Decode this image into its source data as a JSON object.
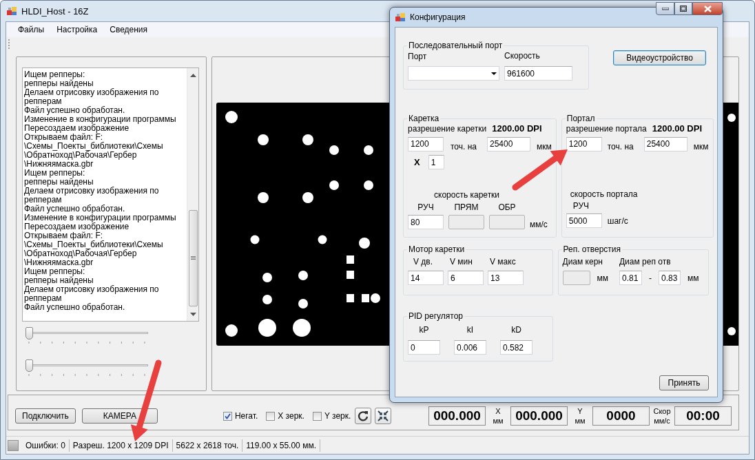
{
  "window": {
    "title": "HLDI_Host - 16Z"
  },
  "menu": [
    "Файлы",
    "Настройка",
    "Сведения"
  ],
  "log": {
    "lines": [
      "Ищем репперы:",
      "репперы найдены",
      "Делаем отрисовку изображения по",
      "репперам",
      "Файл успешно обработан.",
      "Изменение в конфигурации программы",
      "Пересоздаем изображение",
      "Открываем файл: F:",
      "\\Схемы_Поекты_библиотеки\\Схемы",
      "\\Обратноход\\Рабочая\\Гербер",
      "\\Нижняямаска.gbr",
      "Ищем репперы:",
      "репперы найдены",
      "Делаем отрисовку изображения по",
      "репперам",
      "Файл успешно обработан.",
      "Изменение в конфигурации программы",
      "Пересоздаем изображение",
      "Открываем файл: F:",
      "\\Схемы_Поекты_библиотеки\\Схемы",
      "\\Обратноход\\Рабочая\\Гербер",
      "\\Нижняямаска.gbr",
      "Ищем репперы:",
      "репперы найдены",
      "Делаем отрисовку изображения по",
      "репперам",
      "Файл успешно обработан."
    ]
  },
  "sliders": [
    {
      "level": 0
    },
    {
      "level": 0
    }
  ],
  "controls": {
    "buttons": [
      "Подключить",
      "КАМЕРА"
    ],
    "checkboxes": [
      {
        "label": "Негат.",
        "checked": true
      },
      {
        "label": "X зерк.",
        "checked": false
      },
      {
        "label": "Y зерк.",
        "checked": false
      }
    ]
  },
  "readouts": [
    {
      "value": "000.000",
      "label_top": "X",
      "label_bottom": "мм"
    },
    {
      "value": "000.000",
      "label_top": "Y",
      "label_bottom": "мм"
    },
    {
      "value": "0000",
      "label_top": "Скор",
      "label_bottom": "мм/с"
    },
    {
      "value": "00:00"
    }
  ],
  "status_bar": [
    "Ошибки: 0",
    "Разреш. 1200 x 1209 DPI",
    "5622 x 2618 точ.",
    "119.00 x 55.00 мм."
  ],
  "dialog": {
    "title": "Конфигурация",
    "serial_port": {
      "title": "Последовательный порт",
      "port_label": "Порт",
      "speed_label": "Скорость",
      "speed_value": "961600"
    },
    "video_button": "Видеоустройство",
    "carriage": {
      "title": "Каретка",
      "resolution_label": "разрешение каретки",
      "resolution": "1200.00 DPI",
      "dots": "1200",
      "dots_unit": "точ. на",
      "microns": "25400",
      "microns_unit": "мкм",
      "multiplier_label": "X",
      "multiplier": "1",
      "speed_title": "скорость каретки",
      "speeds": [
        {
          "label": "РУЧ",
          "value": "80",
          "disabled": false
        },
        {
          "label": "ПРЯМ",
          "disabled": true
        },
        {
          "label": "ОБР",
          "disabled": true
        }
      ],
      "speed_unit": "мм/с"
    },
    "portal": {
      "title": "Портал",
      "resolution_label": "разрешение портала",
      "resolution": "1200.00 DPI",
      "dots": "1200",
      "dots_unit": "точ. на",
      "microns": "25400",
      "microns_unit": "мкм",
      "speed_title": "скорость портала",
      "speed_label": "РУЧ",
      "speed": "5000",
      "speed_unit": "шаг/с"
    },
    "motor": {
      "title": "Мотор каретки",
      "fields": [
        {
          "label": "V дв.",
          "value": "14"
        },
        {
          "label": "V мин",
          "value": "6"
        },
        {
          "label": "V макс",
          "value": "13"
        }
      ]
    },
    "holes": {
      "title": "Реп. отверстия",
      "core_label": "Диам керн",
      "core_disabled": true,
      "core_unit": "мм",
      "diameter_label": "Диам реп отв",
      "min": "0.81",
      "separator": "-",
      "max": "0.83",
      "unit": "мм"
    },
    "pid": {
      "title": "PID регулятор",
      "fields": [
        {
          "label": "kP",
          "value": "0"
        },
        {
          "label": "kI",
          "value": "0.006"
        },
        {
          "label": "kD",
          "value": "0.582"
        }
      ]
    },
    "accept_button": "Принять"
  }
}
